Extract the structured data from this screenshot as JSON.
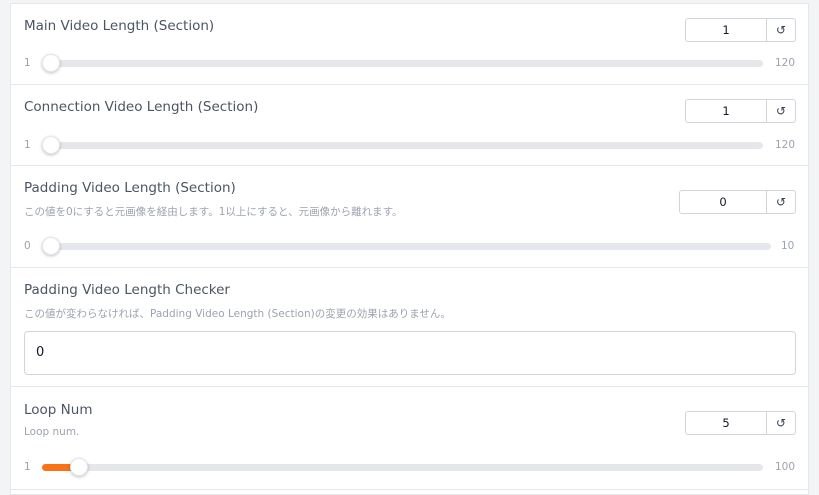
{
  "reset_icon_glyph": "↺",
  "colors": {
    "accent": "#f97316"
  },
  "settings": [
    {
      "label": "Main Video Length (Section)",
      "info": "",
      "value": "1",
      "min": "1",
      "max": "120",
      "level_fraction": 0.0
    },
    {
      "label": "Connection Video Length (Section)",
      "info": "",
      "value": "1",
      "min": "1",
      "max": "120",
      "level_fraction": 0.0
    },
    {
      "label": "Padding Video Length (Section)",
      "info": "この値を0にすると元画像を経由します。1以上にすると、元画像から離れます。",
      "value": "0",
      "min": "0",
      "max": "10",
      "level_fraction": 0.0
    },
    {
      "label": "Padding Video Length Checker",
      "info": "この値が変わらなければ、Padding Video Length (Section)の変更の効果はありません。",
      "value": "0"
    },
    {
      "label": "Loop Num",
      "info": "Loop num.",
      "value": "5",
      "min": "1",
      "max": "100",
      "level_fraction": 0.04
    }
  ]
}
